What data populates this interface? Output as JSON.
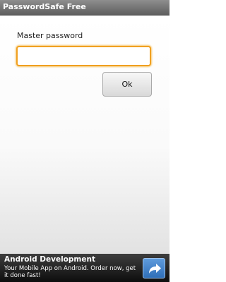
{
  "app": {
    "title": "PasswordSafe Free"
  },
  "login": {
    "label": "Master password",
    "password_value": "",
    "ok_label": "Ok"
  },
  "ad": {
    "title": "Android Development",
    "body": "Your Mobile App on Android. Order now, get it done fast!",
    "icon": "share-arrow-icon"
  }
}
